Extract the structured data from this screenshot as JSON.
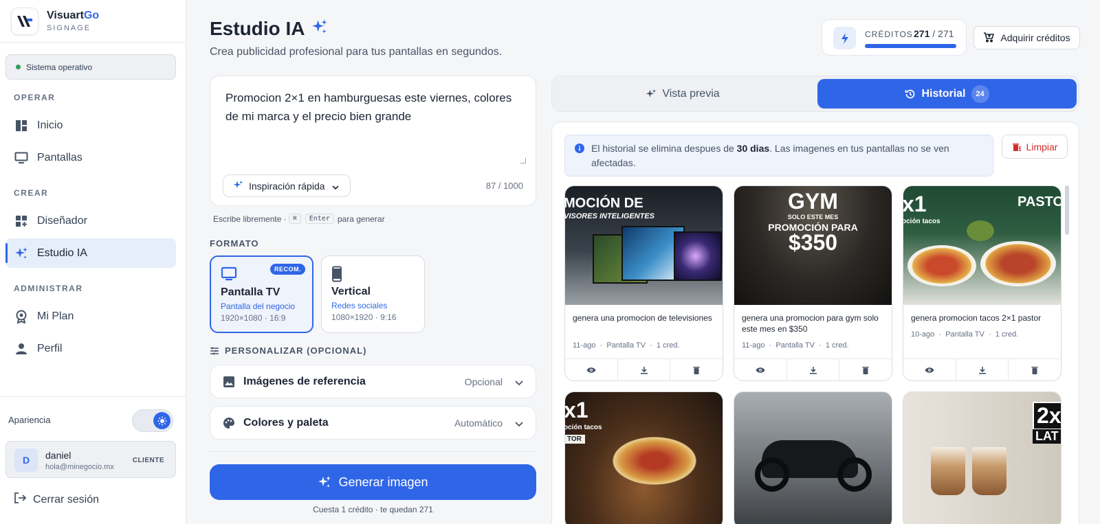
{
  "brand": {
    "name": "Visuart",
    "name_accent": "Go",
    "subtitle": "SIGNAGE"
  },
  "status": {
    "label": "Sistema operativo",
    "color": "#2e9d5a"
  },
  "nav": {
    "sections": [
      "OPERAR",
      "CREAR",
      "ADMINISTRAR"
    ],
    "items": [
      {
        "label": "Inicio",
        "icon": "dashboard-icon"
      },
      {
        "label": "Pantallas",
        "icon": "monitor-icon"
      },
      {
        "label": "Diseñador",
        "icon": "designer-icon"
      },
      {
        "label": "Estudio IA",
        "icon": "sparkle-icon",
        "active": true
      },
      {
        "label": "Mi Plan",
        "icon": "plan-badge-icon"
      },
      {
        "label": "Perfil",
        "icon": "person-icon"
      }
    ]
  },
  "appearance": {
    "label": "Apariencia",
    "mode_icon": "sun-icon"
  },
  "user": {
    "initial": "D",
    "name": "daniel",
    "email": "hola@minegocio.mx",
    "role": "CLIENTE"
  },
  "logout_label": "Cerrar sesión",
  "header": {
    "title": "Estudio IA",
    "subtitle": "Crea publicidad profesional para tus pantallas en segundos."
  },
  "credits": {
    "label": "CRÉDITOS",
    "current": "271",
    "separator": "/ 271",
    "level": 1.0,
    "buy_label": "Adquirir créditos"
  },
  "prompt": {
    "value": "Promocion 2×1 en hamburguesas este viernes, colores de mi marca y el precio bien grande",
    "counter": "87 / 1000",
    "inspiration_label": "Inspiración rápida",
    "hint_before": "Escribe libremente ·",
    "hint_key1": "⌘",
    "hint_key2": "Enter",
    "hint_after": "para generar"
  },
  "format": {
    "label": "FORMATO",
    "options": [
      {
        "title": "Pantalla TV",
        "subtitle": "Pantalla del negocio",
        "spec": "1920×1080 · 16:9",
        "badge": "RECOM.",
        "selected": true
      },
      {
        "title": "Vertical",
        "subtitle": "Redes sociales",
        "spec": "1080×1920 · 9:16"
      }
    ]
  },
  "customize": {
    "label": "PERSONALIZAR (OPCIONAL)",
    "items": [
      {
        "title": "Imágenes de referencia",
        "value": "Opcional"
      },
      {
        "title": "Colores y paleta",
        "value": "Automático"
      }
    ]
  },
  "generate": {
    "label": "Generar imagen",
    "cost": "Cuesta 1 crédito · te quedan 271"
  },
  "tabs": {
    "preview": "Vista previa",
    "history": "Historial",
    "history_count": "24"
  },
  "history": {
    "info_before": "El historial se elimina despues de ",
    "info_bold": "30 dias",
    "info_after": ". Las imagenes en tus pantallas no se ven afectadas.",
    "clear_label": "Limpiar",
    "items": [
      {
        "caption": "genera una promocion de televisiones",
        "date": "11-ago",
        "format": "Pantalla TV",
        "cost": "1 cred.",
        "img_text1": "MOCIÓN DE",
        "img_text2": "VISORES INTELIGENTES"
      },
      {
        "caption": "genera una promocion para gym solo este mes en $350",
        "date": "11-ago",
        "format": "Pantalla TV",
        "cost": "1 cred.",
        "img_text1": "GYM",
        "img_text2": "SOLO ESTE MES",
        "img_text3": "PROMOCIÓN PARA",
        "img_text4": "$350"
      },
      {
        "caption": "genera promocion tacos 2×1 pastor",
        "date": "10-ago",
        "format": "Pantalla TV",
        "cost": "1 cred.",
        "img_text1": "x1",
        "img_text2": "oción tacos",
        "img_text3": "PASTO"
      },
      {
        "img_text1": "x1",
        "img_text2": "oción tacos",
        "img_text3": "TOR"
      },
      {},
      {
        "img_text1": "2x",
        "img_text2": "LAT"
      }
    ]
  },
  "colors": {
    "accent": "#2f66e8",
    "danger": "#d12b2b"
  }
}
